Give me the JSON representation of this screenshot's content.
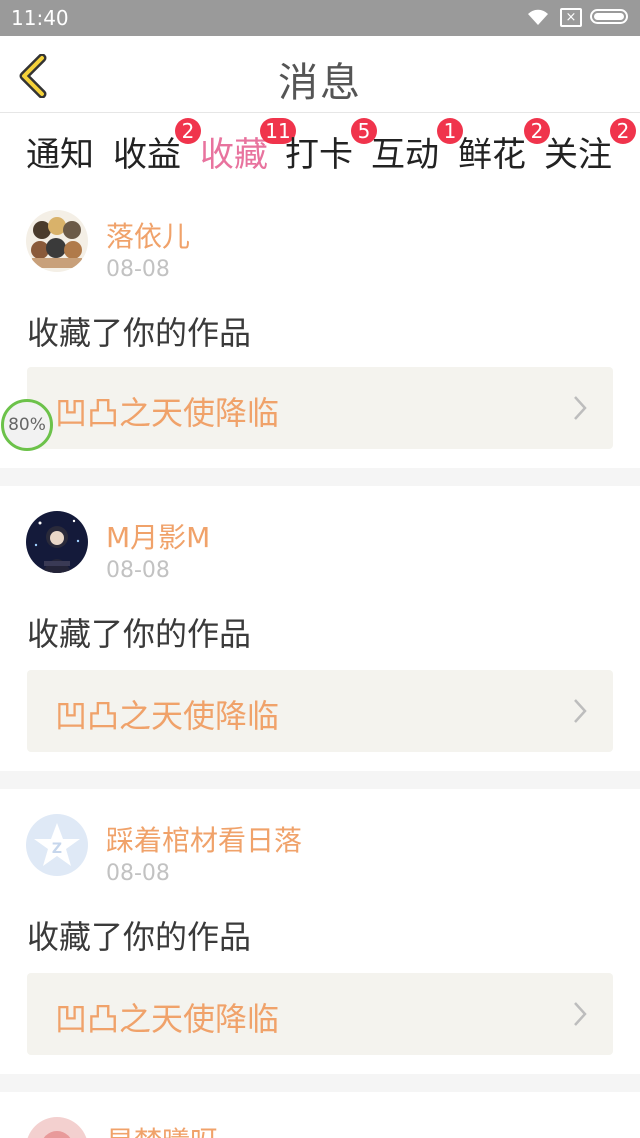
{
  "status_bar": {
    "time": "11:40",
    "battery_level": 1.0
  },
  "header": {
    "title": "消息"
  },
  "tabs": [
    {
      "label": "通知",
      "badge": "",
      "active": false
    },
    {
      "label": "收益",
      "badge": "2",
      "active": false
    },
    {
      "label": "收藏",
      "badge": "11",
      "active": true
    },
    {
      "label": "打卡",
      "badge": "5",
      "active": false
    },
    {
      "label": "互动",
      "badge": "1",
      "active": false
    },
    {
      "label": "鲜花",
      "badge": "2",
      "active": false
    },
    {
      "label": "关注",
      "badge": "2",
      "active": false
    }
  ],
  "messages": [
    {
      "user": "落依儿",
      "date": "08-08",
      "text": "收藏了你的作品",
      "work_title": "凹凸之天使降临"
    },
    {
      "user": "M月影M",
      "date": "08-08",
      "text": "收藏了你的作品",
      "work_title": "凹凸之天使降临"
    },
    {
      "user": "踩着棺材看日落",
      "date": "08-08",
      "text": "收藏了你的作品",
      "work_title": "凹凸之天使降临"
    },
    {
      "user": "星梦曦呀",
      "date": "",
      "text": "",
      "work_title": ""
    }
  ],
  "floating_widget": {
    "label": "80%"
  },
  "colors": {
    "accent": "#e8739e",
    "badge": "#f0344c",
    "username": "#f0a26a",
    "work_bg": "#f4f3ee"
  }
}
